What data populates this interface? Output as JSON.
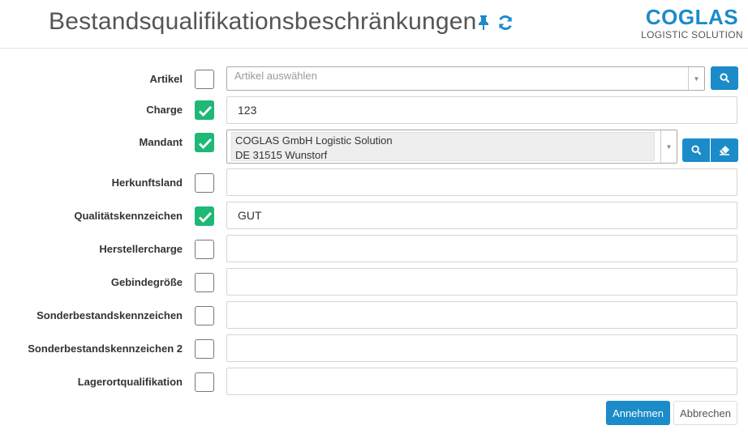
{
  "header": {
    "title": "Bestandsqualifikationsbeschränkungen",
    "pin_icon": "thumbtack-icon",
    "refresh_icon": "refresh-icon"
  },
  "logo": {
    "main": "COGLAS",
    "sub": "LOGISTIC SOLUTION",
    "color": "#1b8bc9"
  },
  "colors": {
    "accent": "#1b8bc9",
    "checked": "#1fb877"
  },
  "rows": [
    {
      "label": "Artikel",
      "checked": false,
      "type": "select",
      "placeholder": "Artikel auswählen",
      "buttons": [
        "search"
      ]
    },
    {
      "label": "Charge",
      "checked": true,
      "type": "text",
      "value": "123"
    },
    {
      "label": "Mandant",
      "checked": true,
      "type": "select",
      "value_lines": [
        "COGLAS GmbH Logistic Solution",
        "DE 31515 Wunstorf"
      ],
      "buttons": [
        "search",
        "eraser"
      ]
    },
    {
      "label": "Herkunftsland",
      "checked": false,
      "type": "text",
      "value": ""
    },
    {
      "label": "Qualitätskennzeichen",
      "checked": true,
      "type": "text",
      "value": "GUT"
    },
    {
      "label": "Herstellercharge",
      "checked": false,
      "type": "text",
      "value": ""
    },
    {
      "label": "Gebindegröße",
      "checked": false,
      "type": "text",
      "value": ""
    },
    {
      "label": "Sonderbestandskennzeichen",
      "checked": false,
      "type": "text",
      "value": ""
    },
    {
      "label": "Sonderbestandskennzeichen 2",
      "checked": false,
      "type": "text",
      "value": ""
    },
    {
      "label": "Lagerortqualifikation",
      "checked": false,
      "type": "text",
      "value": ""
    }
  ],
  "footer": {
    "accept_label": "Annehmen",
    "cancel_label": "Abbrechen"
  }
}
